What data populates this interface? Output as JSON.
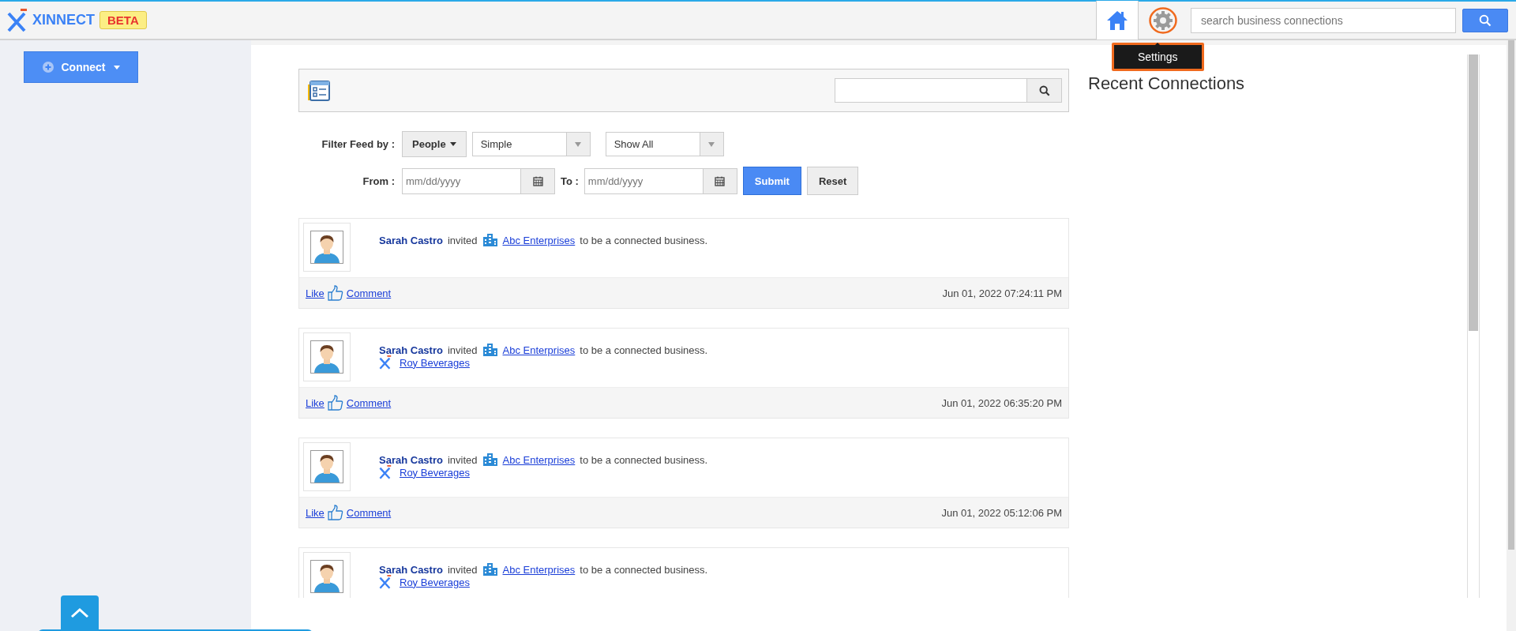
{
  "header": {
    "brand": "XINNECT",
    "badge": "BETA",
    "search": {
      "placeholder": "search business connections"
    },
    "tooltip": "Settings"
  },
  "sidebar": {
    "connect_button": "Connect"
  },
  "filters": {
    "label": "Filter Feed by :",
    "people_button": "People",
    "view_select": "Simple",
    "show_select": "Show All",
    "from_label": "From :",
    "from": {
      "placeholder": "mm/dd/yyyy"
    },
    "to_label": "To :",
    "to": {
      "placeholder": "mm/dd/yyyy"
    },
    "submit": "Submit",
    "reset": "Reset"
  },
  "feed": [
    {
      "author": "Sarah Castro",
      "verb": "invited",
      "business": "Abc Enterprises",
      "suffix": "to be a connected business.",
      "like": "Like",
      "comment": "Comment",
      "time": "Jun 01, 2022 07:24:11 PM"
    },
    {
      "author": "Sarah Castro",
      "verb": "invited",
      "business": "Abc Enterprises",
      "suffix": "to be a connected business.",
      "sub_business": "Roy Beverages",
      "like": "Like",
      "comment": "Comment",
      "time": "Jun 01, 2022 06:35:20 PM"
    },
    {
      "author": "Sarah Castro",
      "verb": "invited",
      "business": "Abc Enterprises",
      "suffix": "to be a connected business.",
      "sub_business": "Roy Beverages",
      "like": "Like",
      "comment": "Comment",
      "time": "Jun 01, 2022 05:12:06 PM"
    },
    {
      "author": "Sarah Castro",
      "verb": "invited",
      "business": "Abc Enterprises",
      "suffix": "to be a connected business.",
      "sub_business": "Roy Beverages"
    }
  ],
  "recent": {
    "title": "Recent Connections"
  }
}
